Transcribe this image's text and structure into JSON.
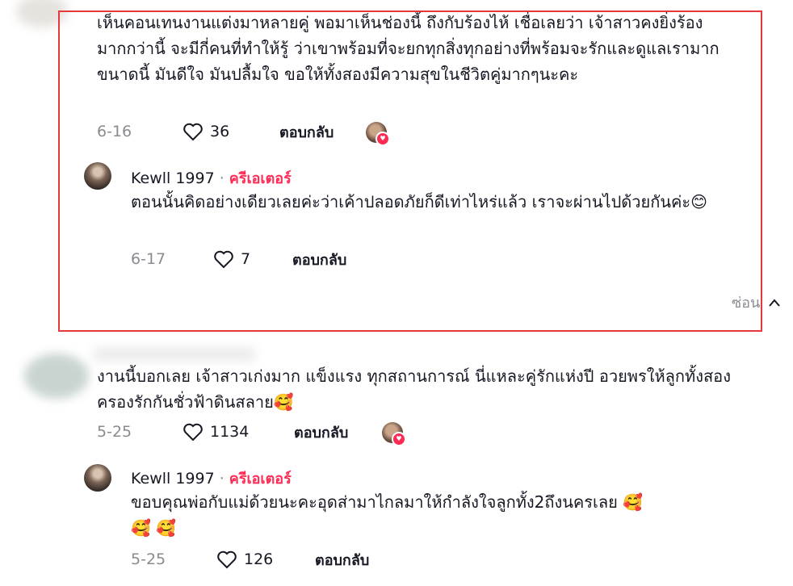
{
  "comments": [
    {
      "text": "เห็นคอนเทนงานแต่งมาหลายคู่ พอมาเห็นช่องนี้ ถึงกับร้องไห้ เชื่อเลยว่า เจ้าสาวคงยิ่งร้องมากกว่านี้ จะมีกี่คนที่ทำให้รู้ ว่าเขาพร้อมที่จะยกทุกสิ่งทุกอย่างที่พร้อมจะรักและดูแลเรามากขนาดนี้ มันดีใจ มันปลื้มใจ ขอให้ทั้งสองมีความสุขในชีวิตคู่มากๆนะคะ",
      "date": "6-16",
      "likes": "36",
      "reply_label": "ตอบกลับ",
      "reply": {
        "author": "Kewll 1997",
        "separator": "·",
        "creator_tag": "ครีเอเตอร์",
        "text": "ตอนนั้นคิดอย่างเดียวเลยค่ะว่าเค้าปลอดภัยก็ดีเท่าไหร่แล้ว เราจะผ่านไปด้วยกันค่ะ",
        "emoji": "😊",
        "date": "6-17",
        "likes": "7",
        "reply_label": "ตอบกลับ"
      }
    },
    {
      "text": "งานนี้บอกเลย เจ้าสาวเก่งมาก แข็งแรง ทุกสถานการณ์ นี่แหละคู่รักแห่งปี อวยพรให้ลูกทั้งสองครองรักกันชั่วฟ้าดินสลาย",
      "emoji": "🥰",
      "date": "5-25",
      "likes": "1134",
      "reply_label": "ตอบกลับ",
      "reply": {
        "author": "Kewll 1997",
        "separator": "·",
        "creator_tag": "ครีเอเตอร์",
        "text": "ขอบคุณพ่อกับแม่ด้วยนะคะอุดส่ามาไกลมาให้กำลังใจลูกทั้ง2ถึงนครเลย",
        "emoji": "🥰",
        "emoji2": "🥰 🥰",
        "date": "5-25",
        "likes": "126",
        "reply_label": "ตอบกลับ"
      }
    }
  ],
  "hide_label": "ซ่อน",
  "accent_color": "#fe2c55",
  "highlight_color": "#e5383b"
}
